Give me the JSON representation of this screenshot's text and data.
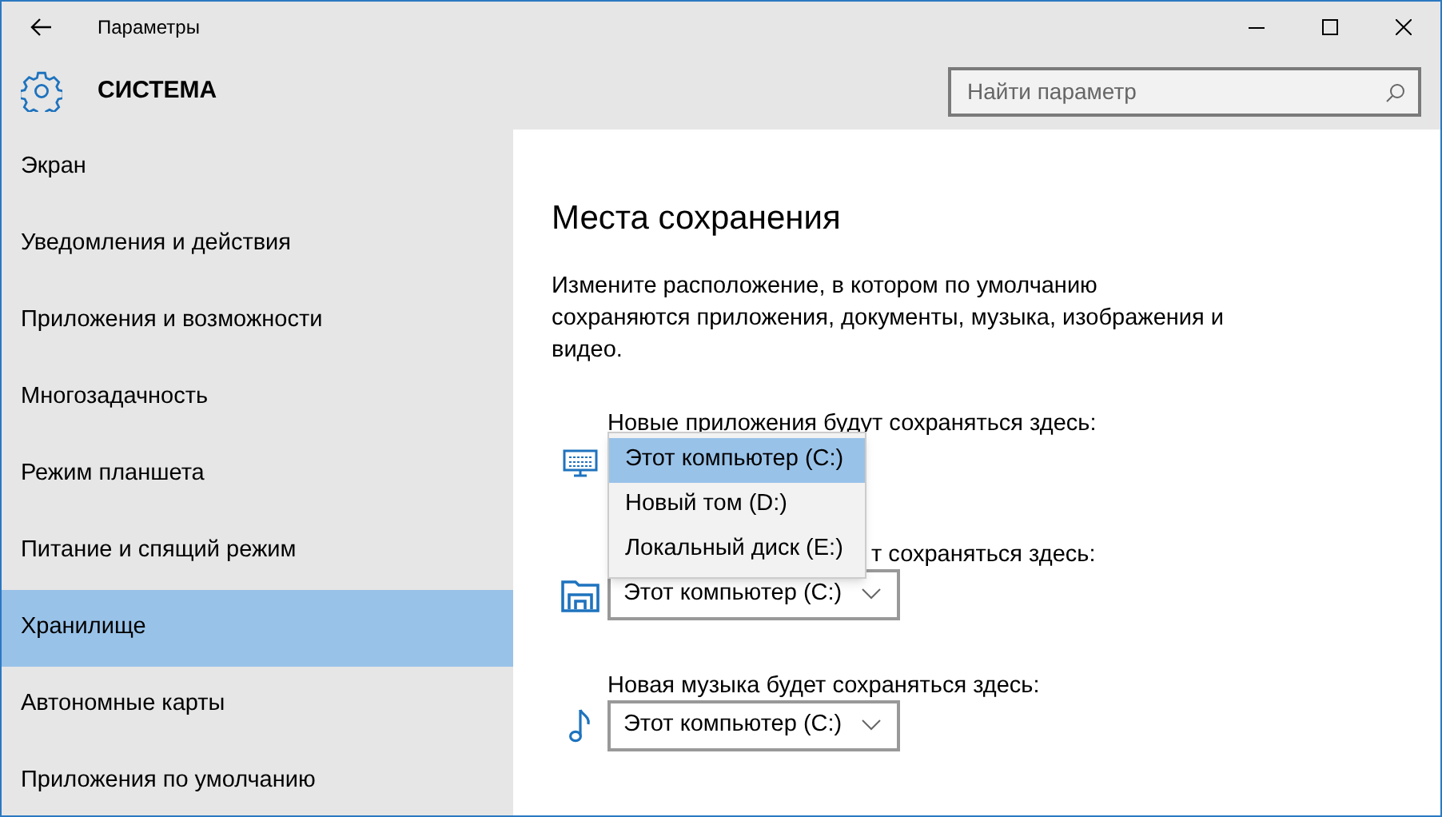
{
  "window": {
    "title": "Параметры"
  },
  "header": {
    "title": "СИСТЕМА"
  },
  "search": {
    "placeholder": "Найти параметр"
  },
  "sidebar": {
    "items": [
      {
        "label": "Экран",
        "selected": false
      },
      {
        "label": "Уведомления и действия",
        "selected": false
      },
      {
        "label": "Приложения и возможности",
        "selected": false
      },
      {
        "label": "Многозадачность",
        "selected": false
      },
      {
        "label": "Режим планшета",
        "selected": false
      },
      {
        "label": "Питание и спящий режим",
        "selected": false
      },
      {
        "label": "Хранилище",
        "selected": true
      },
      {
        "label": "Автономные карты",
        "selected": false
      },
      {
        "label": "Приложения по умолчанию",
        "selected": false
      }
    ]
  },
  "content": {
    "heading": "Места сохранения",
    "description": "Измените расположение, в котором по умолчанию сохраняются приложения, документы, музыка, изображения и видео.",
    "sections": [
      {
        "kind": "apps",
        "label": "Новые приложения будут сохраняться здесь:",
        "open": true,
        "options": [
          {
            "label": "Этот компьютер (C:)",
            "selected": true
          },
          {
            "label": "Новый том (D:)",
            "selected": false
          },
          {
            "label": "Локальный диск (E:)",
            "selected": false
          }
        ]
      },
      {
        "kind": "documents",
        "label": "т сохраняться здесь:",
        "value": "Этот компьютер (C:)",
        "open": false
      },
      {
        "kind": "music",
        "label": "Новая музыка будет сохраняться здесь:",
        "value": "Этот компьютер (C:)",
        "open": false
      }
    ]
  }
}
